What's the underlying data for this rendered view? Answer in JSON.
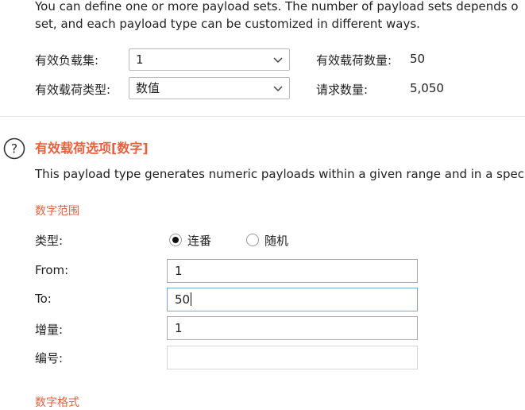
{
  "intro": {
    "line1": "You can define one or more payload sets. The number of payload sets depends o",
    "line2": "set, and each payload type can be customized in different ways."
  },
  "payload_set": {
    "label": "有效负载集:",
    "value": "1"
  },
  "payload_type": {
    "label": "有效载荷类型:",
    "value": "数值"
  },
  "payload_count": {
    "label": "有效载荷数量:",
    "value": "50"
  },
  "request_count": {
    "label": "请求数量:",
    "value": "5,050"
  },
  "options": {
    "title": "有效载荷选项[数字]",
    "description": "This payload type generates numeric payloads within a given range and in a spec"
  },
  "number_range": {
    "title": "数字范围",
    "type_label": "类型:",
    "type_options": [
      "连番",
      "随机"
    ],
    "selected_type": "连番",
    "from_label": "From:",
    "from_value": "1",
    "to_label": "To:",
    "to_value": "50",
    "step_label": "增量:",
    "step_value": "1",
    "howmany_label": "编号:",
    "howmany_value": ""
  },
  "number_format": {
    "title": "数字格式"
  },
  "colors": {
    "accent": "#e8603c",
    "focus_border": "#7fa7d6"
  }
}
